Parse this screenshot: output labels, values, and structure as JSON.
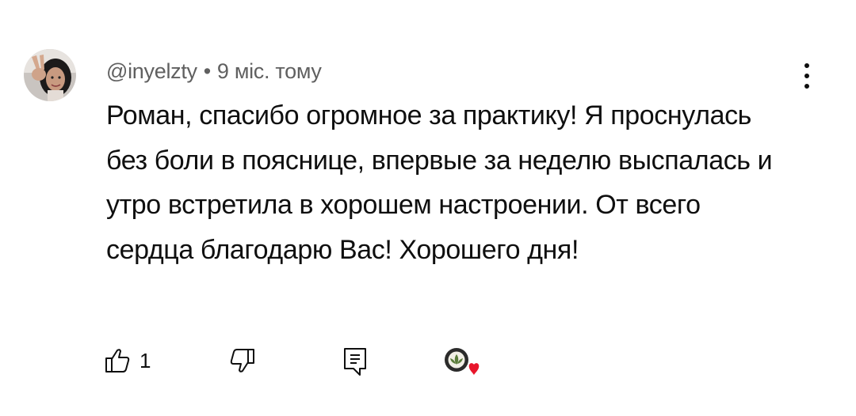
{
  "comment": {
    "author": "@inyelzty",
    "separator": "•",
    "time": "9 міс. тому",
    "text": "Роман, спасибо огромное за практику! Я проснулась без боли в пояснице, впервые за неделю выспалась и утро встретила в хорошем настроении. От всего сердца благодарю Вас! Хорошего дня!",
    "like_count": "1"
  },
  "icons": {
    "menu": "more-vert-icon",
    "like": "thumb-up-icon",
    "dislike": "thumb-down-icon",
    "reply": "reply-icon",
    "creator_heart": "creator-heart-icon"
  },
  "colors": {
    "text_primary": "#0f0f0f",
    "text_secondary": "#606060",
    "heart": "#e8162b"
  }
}
